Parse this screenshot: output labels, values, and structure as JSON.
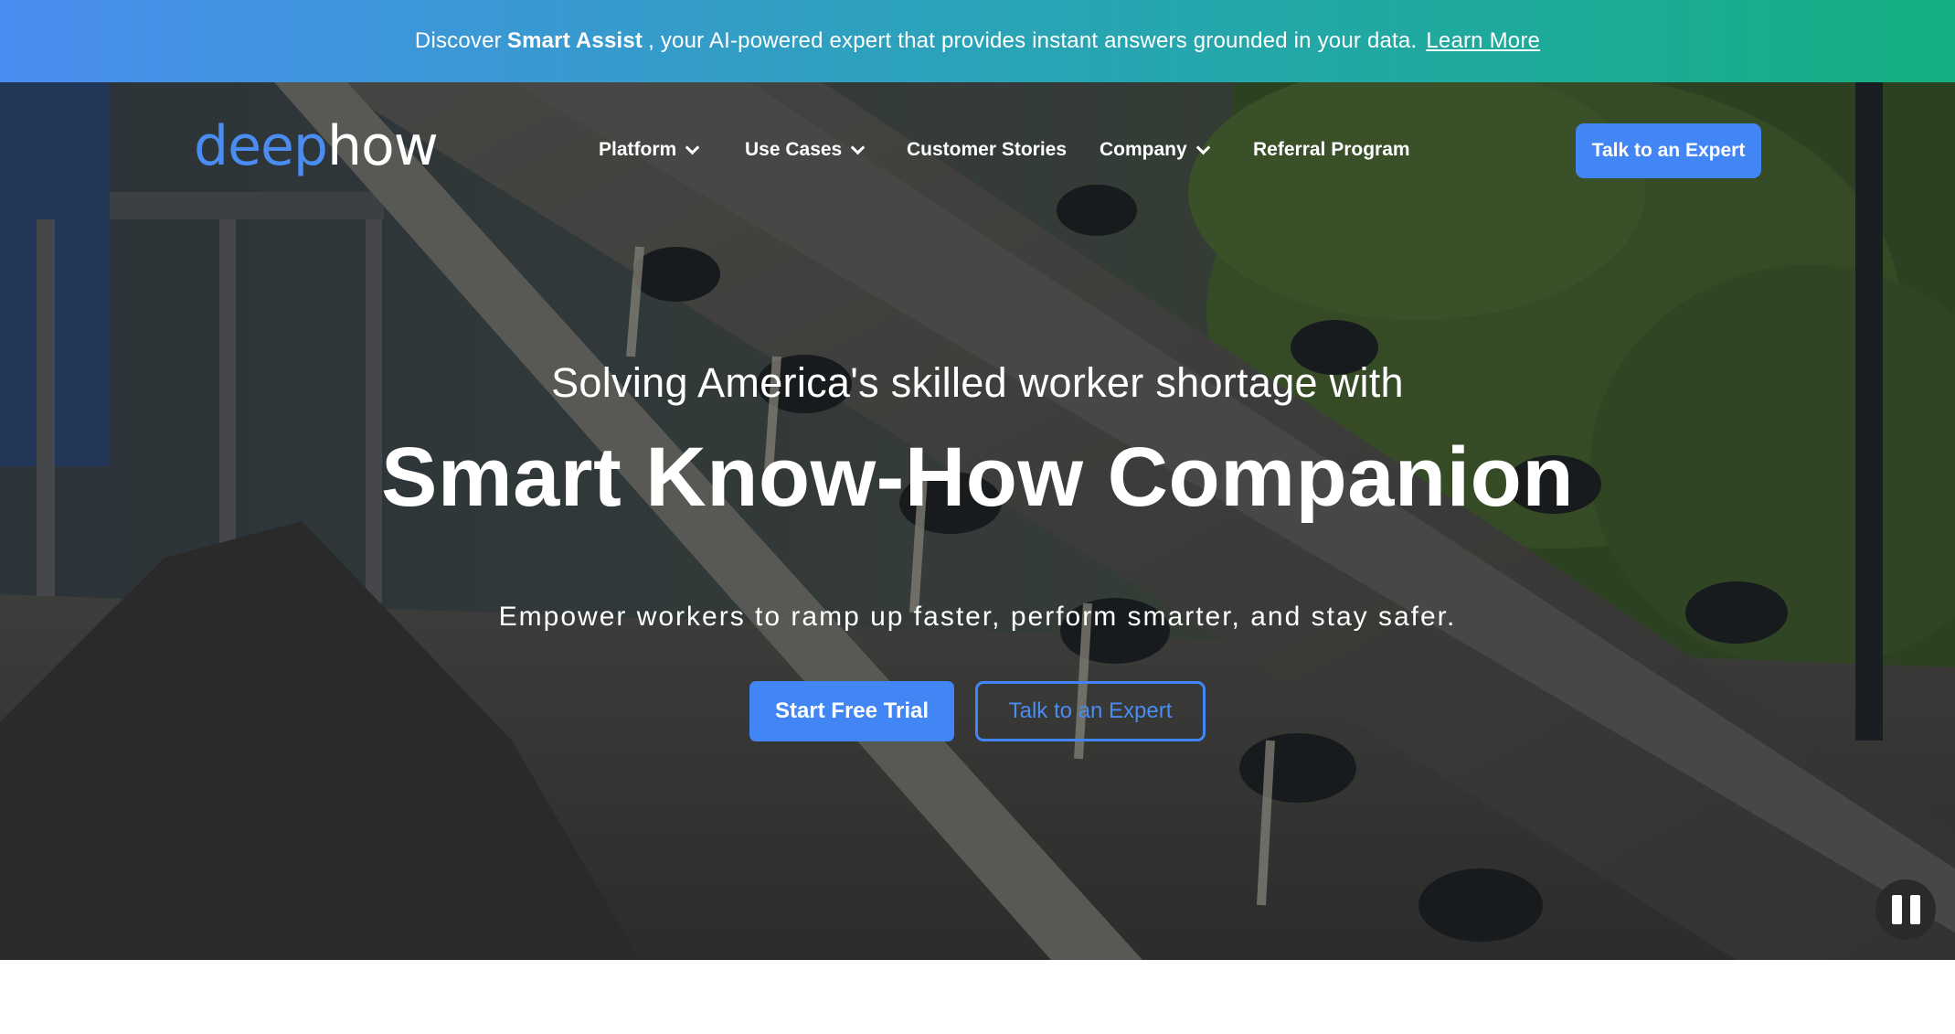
{
  "announcement": {
    "prefix": "Discover",
    "highlight": "Smart Assist",
    "suffix": ", your AI-powered expert that provides instant answers grounded in your data.",
    "link_label": "Learn More"
  },
  "nav": {
    "logo_part1": "deep",
    "logo_part2": "how",
    "items": [
      {
        "label": "Platform",
        "has_dropdown": true
      },
      {
        "label": "Use Cases",
        "has_dropdown": true
      },
      {
        "label": "Customer Stories",
        "has_dropdown": false
      },
      {
        "label": "Company",
        "has_dropdown": true
      },
      {
        "label": "Referral Program",
        "has_dropdown": false
      }
    ],
    "cta_label": "Talk to an Expert"
  },
  "hero": {
    "kicker": "Solving America's skilled worker shortage with",
    "headline": "Smart Know-How Companion",
    "subheadline": "Empower workers to ramp up faster, perform smarter, and stay safer.",
    "primary_button": "Start Free Trial",
    "secondary_button": "Talk to an Expert",
    "media_control_icon": "pause-icon"
  },
  "colors": {
    "accent": "#4286f5",
    "gradient_start": "#4a8df0",
    "gradient_end": "#14b083"
  }
}
